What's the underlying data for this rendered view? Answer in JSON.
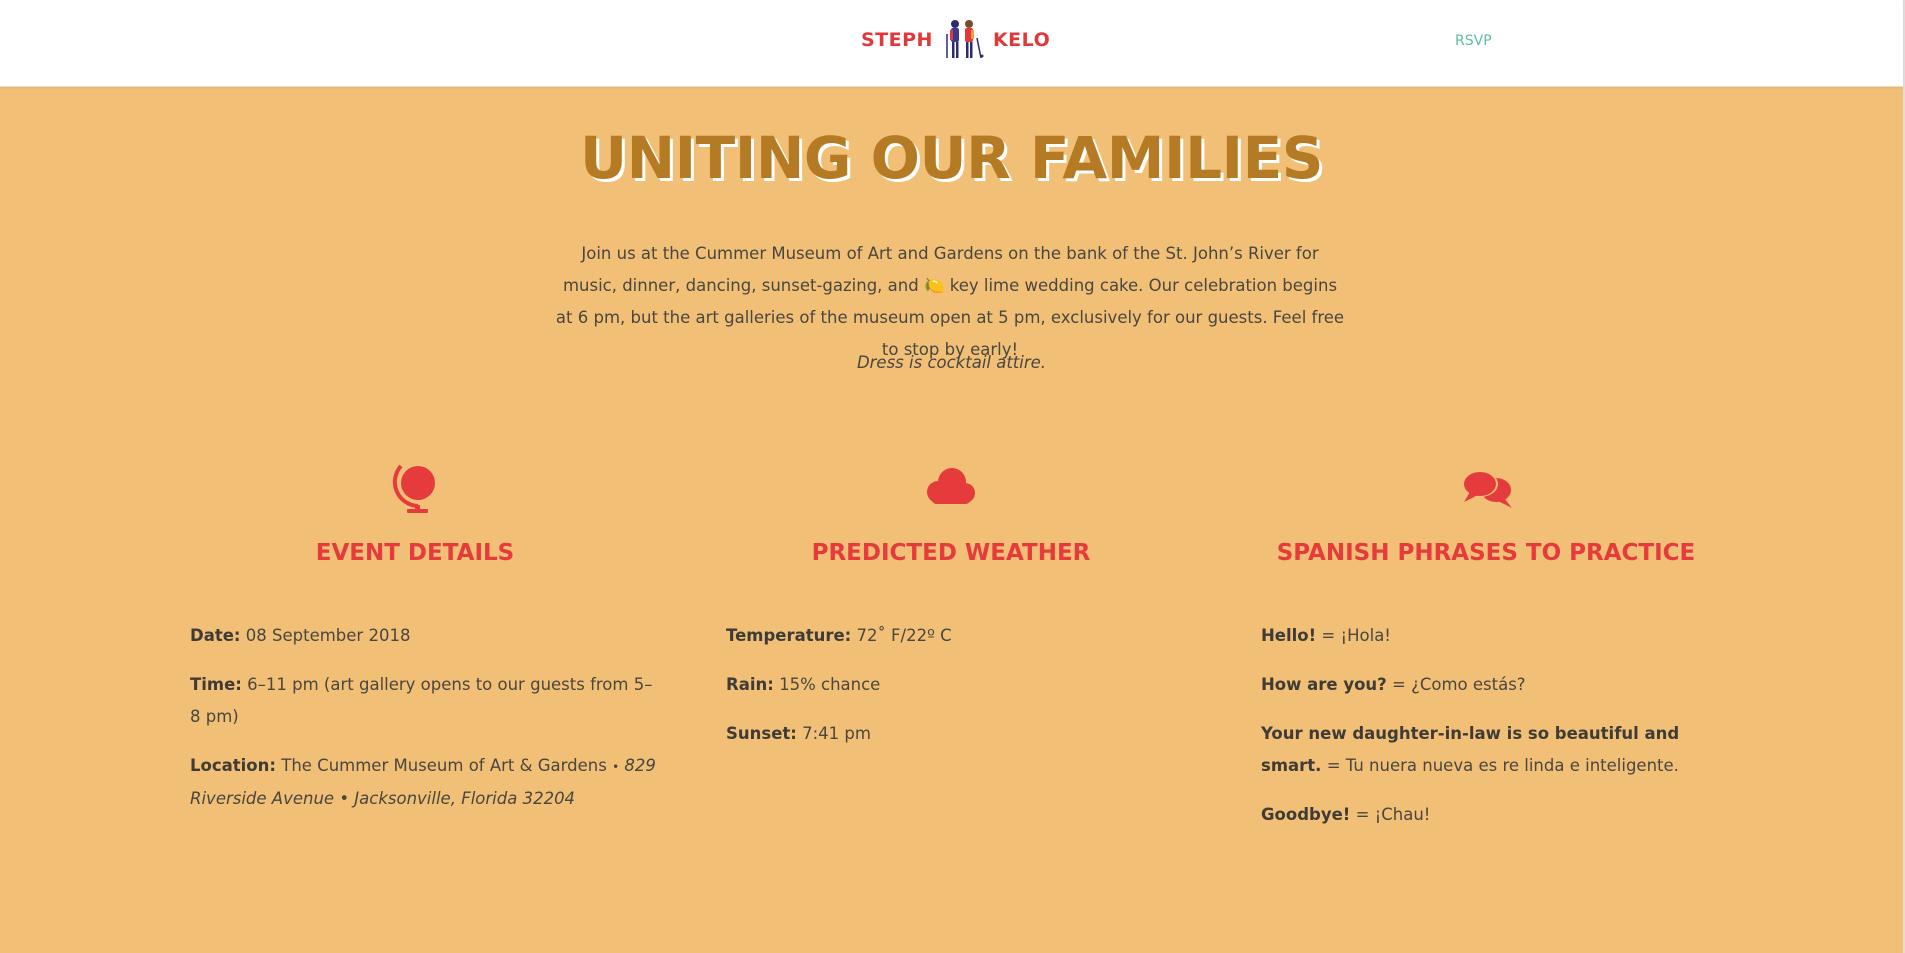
{
  "header": {
    "logo_left": "STEPH",
    "logo_right": "KELO",
    "rsvp_label": "RSVP"
  },
  "hero": {
    "title": "UNITING OUR FAMILIES",
    "intro_1": "Join us at the Cummer Museum of Art and Gardens on the bank of the St. John’s River for music, dinner, dancing, sunset-gazing, and",
    "intro_emoji": "🍋",
    "intro_2": "key lime wedding cake. Our celebration begins at 6 pm, but the art galleries of the museum open at 5 pm, exclusively for our guests. Feel free to stop by early!",
    "attire": "Dress is cocktail attire."
  },
  "sections": {
    "event": {
      "icon": "globe-icon",
      "title": "EVENT DETAILS",
      "date_label": "Date:",
      "date_value": "08 September 2018",
      "time_label": "Time:",
      "time_value": "6–11 pm (art gallery opens to our guests from 5–8 pm)",
      "location_label": "Location:",
      "location_value": "The Cummer Museum of Art & Gardens",
      "location_sep": "•",
      "location_address": "829 Riverside Avenue • Jacksonville, Florida 32204"
    },
    "weather": {
      "icon": "cloud-icon",
      "title": "PREDICTED WEATHER",
      "temp_label": "Temperature:",
      "temp_value": "72˚ F/22º C",
      "rain_label": "Rain:",
      "rain_value": "15% chance",
      "sunset_label": "Sunset:",
      "sunset_value": "7:41 pm"
    },
    "spanish": {
      "icon": "speech-bubbles-icon",
      "title": "SPANISH PHRASES TO PRACTICE",
      "phrases": [
        {
          "en": "Hello!",
          "eq": "=",
          "es": "¡Hola!"
        },
        {
          "en": "How are you?",
          "eq": "=",
          "es": "¿Como estás?"
        },
        {
          "en": "Your new daughter-in-law is so beautiful and smart.",
          "eq": "=",
          "es": "Tu nuera nueva es re linda e inteligente."
        },
        {
          "en": "Goodbye!",
          "eq": "=",
          "es": "¡Chau!"
        }
      ]
    }
  },
  "colors": {
    "background": "#f1bf76",
    "accent_red": "#e53b3c",
    "title_gold": "#b57a24",
    "link_green": "#5cc0a0"
  }
}
